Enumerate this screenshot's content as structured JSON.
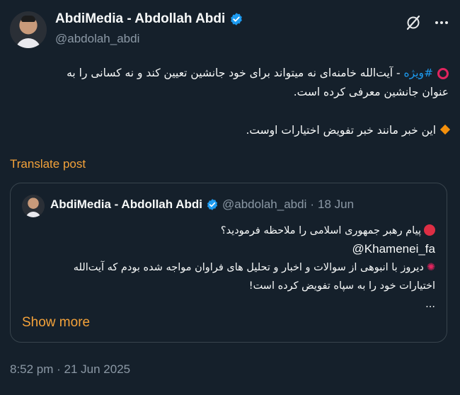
{
  "author": {
    "display_name": "AbdiMedia - Abdollah Abdi",
    "handle": "@abdolah_abdi"
  },
  "post": {
    "hashtag": "#ویژه",
    "line1_rest": " - آیت‌الله خامنه‌ای نه میتواند برای خود جانشین تعیین کند و نه کسانی را به",
    "line2": "عنوان جانشین معرفی کرده است.",
    "line3": "این خبر مانند خبر تفویض اختیارات اوست."
  },
  "translate_label": "Translate post",
  "quoted": {
    "display_name": "AbdiMedia - Abdollah Abdi",
    "handle": "@abdolah_abdi",
    "separator": "·",
    "date": "18 Jun",
    "line1": "پیام رهبر جمهوری اسلامی را ملاحظه فرمودید؟",
    "mention": "@Khamenei_fa",
    "line3": "دیروز با انبوهی از سوالات و اخبار و تحلیل های فراوان مواجه شده بودم که آیت‌الله",
    "line4": "اختیارات خود را به سپاه تفویض کرده است!",
    "ellipsis": "...",
    "show_more_label": "Show more"
  },
  "timestamp": "8:52 pm · 21 Jun 2025",
  "colors": {
    "background": "#15202b",
    "link": "#1d9bf0",
    "accent": "#f4a23a",
    "muted": "#8b98a5",
    "verified": "#1d9bf0"
  }
}
